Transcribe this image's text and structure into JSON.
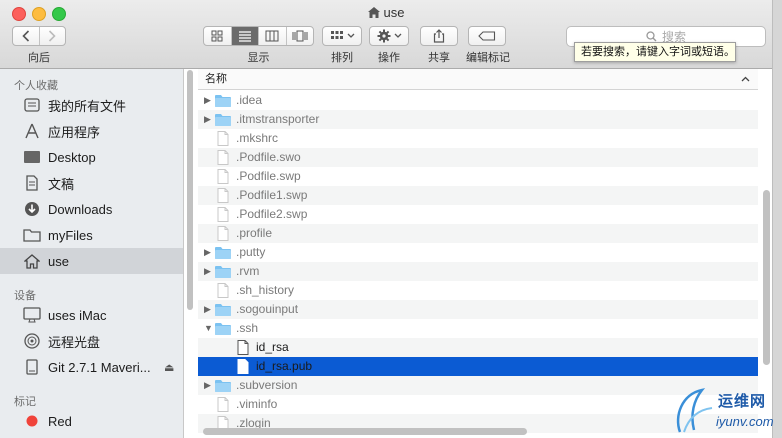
{
  "window": {
    "title": "use"
  },
  "toolbar": {
    "back_label": "向后",
    "view_label": "显示",
    "arrange_label": "排列",
    "action_label": "操作",
    "share_label": "共享",
    "tags_label": "编辑标记"
  },
  "search": {
    "placeholder": "搜索",
    "tooltip": "若要搜索，请键入字词或短语。"
  },
  "sidebar": {
    "favorites_header": "个人收藏",
    "favorites": [
      {
        "label": "我的所有文件",
        "icon": "all-files-icon"
      },
      {
        "label": "应用程序",
        "icon": "applications-icon"
      },
      {
        "label": "Desktop",
        "icon": "desktop-icon"
      },
      {
        "label": "文稿",
        "icon": "documents-icon"
      },
      {
        "label": "Downloads",
        "icon": "downloads-icon"
      },
      {
        "label": "myFiles",
        "icon": "folder-icon"
      },
      {
        "label": "use",
        "icon": "home-icon",
        "selected": true
      }
    ],
    "devices_header": "设备",
    "devices": [
      {
        "label": "uses iMac",
        "icon": "imac-icon"
      },
      {
        "label": "远程光盘",
        "icon": "disc-icon"
      },
      {
        "label": "Git 2.7.1 Maveri...",
        "icon": "drive-icon",
        "eject": "⏏"
      }
    ],
    "tags_header": "标记",
    "tags": [
      {
        "label": "Red",
        "color": "#f0433a"
      }
    ]
  },
  "filelist": {
    "column_name": "名称",
    "rows": [
      {
        "name": ".idea",
        "type": "folder",
        "disclosure": "collapsed"
      },
      {
        "name": ".itmstransporter",
        "type": "folder",
        "disclosure": "collapsed"
      },
      {
        "name": ".mkshrc",
        "type": "file"
      },
      {
        "name": ".Podfile.swo",
        "type": "file"
      },
      {
        "name": ".Podfile.swp",
        "type": "file"
      },
      {
        "name": ".Podfile1.swp",
        "type": "file"
      },
      {
        "name": ".Podfile2.swp",
        "type": "file"
      },
      {
        "name": ".profile",
        "type": "file"
      },
      {
        "name": ".putty",
        "type": "folder",
        "disclosure": "collapsed"
      },
      {
        "name": ".rvm",
        "type": "folder",
        "disclosure": "collapsed"
      },
      {
        "name": ".sh_history",
        "type": "file"
      },
      {
        "name": ".sogouinput",
        "type": "folder",
        "disclosure": "collapsed"
      },
      {
        "name": ".ssh",
        "type": "folder",
        "disclosure": "expanded"
      },
      {
        "name": "id_rsa",
        "type": "file",
        "indent": 1
      },
      {
        "name": "id_rsa.pub",
        "type": "file",
        "indent": 1,
        "selected": true
      },
      {
        "name": ".subversion",
        "type": "folder",
        "disclosure": "collapsed"
      },
      {
        "name": ".viminfo",
        "type": "file"
      },
      {
        "name": ".zlogin",
        "type": "file"
      }
    ]
  },
  "watermark": {
    "text": "运维网",
    "url": "iyunv.com"
  }
}
